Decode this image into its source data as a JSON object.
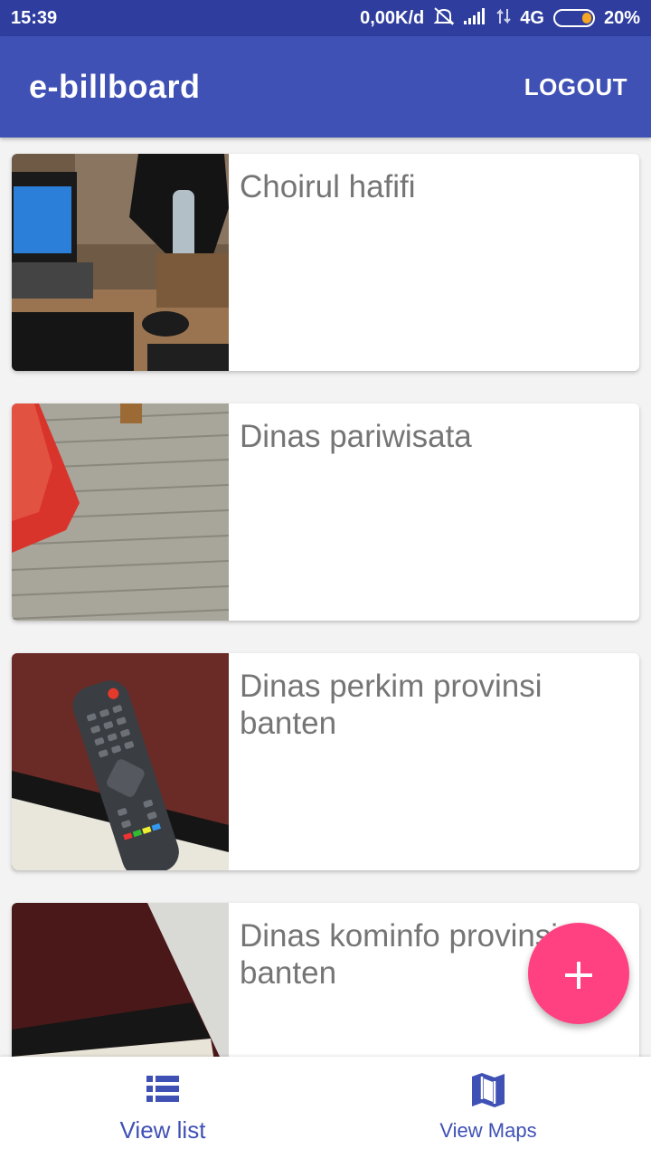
{
  "status": {
    "time": "15:39",
    "network_speed": "0,00K/d",
    "network_type": "4G",
    "battery_percent": "20%"
  },
  "app_bar": {
    "title": "e-billboard",
    "logout_label": "LOGOUT"
  },
  "items": [
    {
      "name": "Choirul hafifi",
      "thumbnail": "laptop-desk-photo"
    },
    {
      "name": "Dinas pariwisata",
      "thumbnail": "wooden-floor-photo"
    },
    {
      "name": "Dinas perkim provinsi banten",
      "thumbnail": "remote-control-photo"
    },
    {
      "name": "Dinas kominfo provinsi banten",
      "thumbnail": "fabric-photo"
    }
  ],
  "fab": {
    "icon": "plus-icon",
    "label": "+"
  },
  "bottom_nav": {
    "items": [
      {
        "label": "View list",
        "icon": "list-icon",
        "active": true
      },
      {
        "label": "View Maps",
        "icon": "map-icon",
        "active": false
      }
    ]
  },
  "colors": {
    "primary": "#3f51b5",
    "primary_dark": "#2f3e9e",
    "accent": "#ff4081"
  }
}
